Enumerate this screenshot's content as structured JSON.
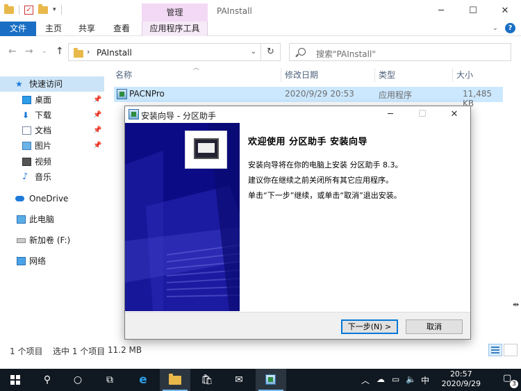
{
  "explorer": {
    "title": "PAInstall",
    "context_tab_header": "管理",
    "ribbon_tabs": [
      "文件",
      "主页",
      "共享",
      "查看",
      "应用程序工具"
    ],
    "address": "PAInstall",
    "search_placeholder": "搜索\"PAInstall\"",
    "columns": {
      "name": "名称",
      "date": "修改日期",
      "type": "类型",
      "size": "大小"
    },
    "files": [
      {
        "name": "PACNPro",
        "date": "2020/9/29 20:53",
        "type": "应用程序",
        "size": "11,485 KB"
      }
    ],
    "nav": {
      "quick_access": "快速访问",
      "desktop": "桌面",
      "downloads": "下载",
      "documents": "文档",
      "pictures": "图片",
      "videos": "视频",
      "music": "音乐",
      "onedrive": "OneDrive",
      "this_pc": "此电脑",
      "drive": "新加卷 (F:)",
      "network": "网络"
    },
    "status": {
      "count": "1 个项目",
      "selected": "选中 1 个项目",
      "size": "11.2 MB"
    }
  },
  "dialog": {
    "title": "安装向导 - 分区助手",
    "heading": "欢迎使用 分区助手 安装向导",
    "lines": [
      "安装向导将在你的电脑上安装 分区助手 8.3。",
      "建议你在继续之前关闭所有其它应用程序。",
      "单击“下一步”继续，或单击“取消”退出安装。"
    ],
    "next_button": "下一步(N) >",
    "cancel_button": "取消"
  },
  "taskbar": {
    "time": "20:57",
    "date": "2020/9/29",
    "ime": "中",
    "notification_count": "3"
  },
  "colors": {
    "accent": "#1a6fc4",
    "selection": "#cce8ff",
    "wizard_side": "#0b0b86",
    "taskbar": "#101922",
    "context_tab": "#f3d9f5"
  }
}
